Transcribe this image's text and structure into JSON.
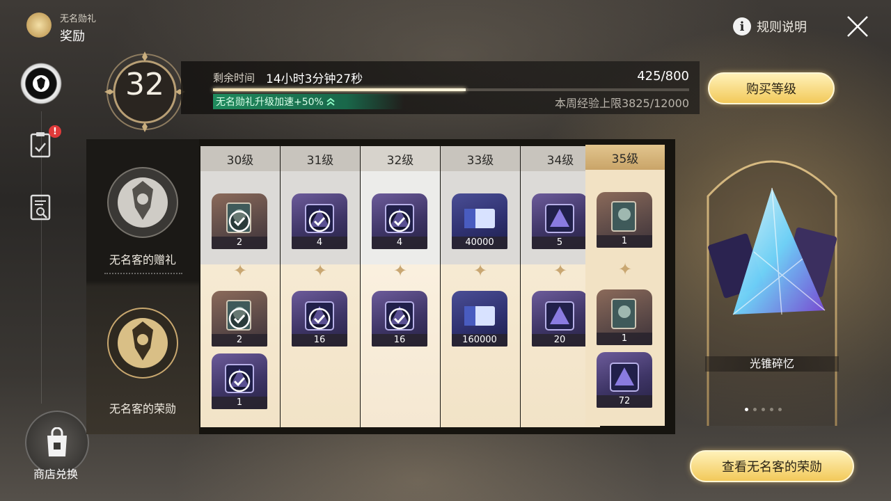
{
  "header": {
    "subtitle": "无名勋礼",
    "title": "奖励",
    "rules_label": "规则说明",
    "rules_icon": "info-icon",
    "close_icon": "close-icon"
  },
  "sidebar": {
    "items": [
      {
        "icon": "pass-emblem-icon",
        "active": true
      },
      {
        "icon": "missions-clipboard-icon",
        "badge": "!"
      },
      {
        "icon": "search-document-icon"
      }
    ],
    "shop_label": "商店兑换"
  },
  "level": {
    "current": "32"
  },
  "progress": {
    "time_label": "剩余时间",
    "time_value": "14小时3分钟27秒",
    "exp_text": "425/800",
    "exp_fraction": 0.53,
    "boost_text": "无名勋礼升级加速+50%",
    "weekly_text": "本周经验上限3825/12000",
    "buy_button": "购买等级"
  },
  "tracks": {
    "free_label": "无名客的赠礼",
    "paid_label": "无名客的荣勋"
  },
  "levels": [
    {
      "label": "30级",
      "free": [
        {
          "qty": "2",
          "claimed": true,
          "tone": "brown"
        }
      ],
      "paid": [
        {
          "qty": "2",
          "claimed": true,
          "tone": "brown"
        },
        {
          "qty": "1",
          "claimed": true,
          "tone": "purple"
        }
      ]
    },
    {
      "label": "31级",
      "free": [
        {
          "qty": "4",
          "claimed": true,
          "tone": "purple"
        }
      ],
      "paid": [
        {
          "qty": "16",
          "claimed": true,
          "tone": "purple"
        }
      ]
    },
    {
      "label": "32级",
      "free": [
        {
          "qty": "4",
          "claimed": true,
          "tone": "purple"
        }
      ],
      "paid": [
        {
          "qty": "16",
          "claimed": true,
          "tone": "purple"
        }
      ]
    },
    {
      "label": "33级",
      "free": [
        {
          "qty": "40000",
          "claimed": false,
          "tone": "blue"
        }
      ],
      "paid": [
        {
          "qty": "160000",
          "claimed": false,
          "tone": "blue"
        }
      ]
    },
    {
      "label": "34级",
      "free": [
        {
          "qty": "5",
          "claimed": false,
          "tone": "purple"
        }
      ],
      "paid": [
        {
          "qty": "20",
          "claimed": false,
          "tone": "purple"
        }
      ]
    },
    {
      "label": "35级",
      "free": [
        {
          "qty": "1",
          "claimed": false,
          "tone": "brown"
        }
      ],
      "paid": [
        {
          "qty": "1",
          "claimed": false,
          "tone": "brown"
        },
        {
          "qty": "72",
          "claimed": false,
          "tone": "purple"
        }
      ]
    }
  ],
  "showcase": {
    "label": "光锥碎忆",
    "page_count": 5,
    "active_page": 1
  },
  "view_button": "查看无名客的荣勋",
  "colors": {
    "accent_gold": "#f2c95a",
    "boost_green": "#1f8a5d",
    "alert_red": "#e03a3a"
  }
}
